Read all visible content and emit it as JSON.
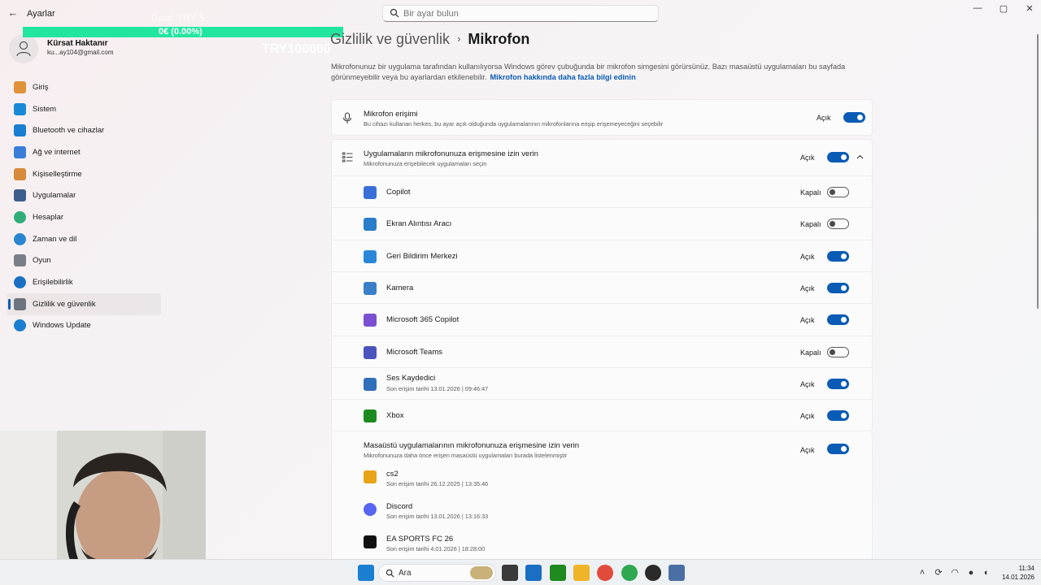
{
  "window": {
    "app_title": "Ayarlar",
    "search_placeholder": "Bir ayar bulun",
    "back_glyph": "←",
    "minimize_glyph": "—",
    "maximize_glyph": "▢",
    "close_glyph": "✕"
  },
  "overlay": {
    "progress_text": "0€ (0.00%)",
    "ghost_text": "Goal: TRY 5",
    "ghost_amount": "TRY100000",
    "bar_color": "#22e6a0"
  },
  "profile": {
    "name": "Kürsat Haktanır",
    "email": "ku...ay104@gmail.com"
  },
  "nav": {
    "items": [
      {
        "label": "Giriş",
        "icon": "home-icon",
        "color": "#e0923a"
      },
      {
        "label": "Sistem",
        "icon": "system-icon",
        "color": "#1a8ad6"
      },
      {
        "label": "Bluetooth ve cihazlar",
        "icon": "bluetooth-icon",
        "color": "#1a7fd0"
      },
      {
        "label": "Ağ ve internet",
        "icon": "network-icon",
        "color": "#3b7ed9"
      },
      {
        "label": "Kişiselleştirme",
        "icon": "brush-icon",
        "color": "#d68a3b"
      },
      {
        "label": "Uygulamalar",
        "icon": "apps-icon",
        "color": "#3d5e8c"
      },
      {
        "label": "Hesaplar",
        "icon": "accounts-icon",
        "color": "#2fae7a"
      },
      {
        "label": "Zaman ve dil",
        "icon": "time-language-icon",
        "color": "#2a86d1"
      },
      {
        "label": "Oyun",
        "icon": "gaming-icon",
        "color": "#7a7f87"
      },
      {
        "label": "Erişilebilirlik",
        "icon": "accessibility-icon",
        "color": "#1a6fc2"
      },
      {
        "label": "Gizlilik ve güvenlik",
        "icon": "shield-icon",
        "color": "#6d7480"
      },
      {
        "label": "Windows Update",
        "icon": "windows-update-icon",
        "color": "#1a7fd0"
      }
    ],
    "selected_index": 10
  },
  "page": {
    "crumb_parent": "Gizlilik ve güvenlik",
    "crumb_sep": "›",
    "crumb_current": "Mikrofon",
    "description": "Mikrofonunuz bir uygulama tarafından kullanılıyorsa Windows görev çubuğunda bir mikrofon simgesini görürsünüz. Bazı masaüstü uygulamaları bu sayfada görünmeyebilir veya bu ayarlardan etkilenebilir.",
    "learn_more": "Mikrofon hakkında daha fazla bilgi edinin"
  },
  "mic_access": {
    "title": "Mikrofon erişimi",
    "subtitle": "Bu cihazı kullanan herkes, bu ayar açık olduğunda uygulamalarının mikrofonlarına erişip erişemeyeceğini seçebilir",
    "state": "Açık"
  },
  "app_access": {
    "title": "Uygulamaların mikrofonunuza erişmesine izin verin",
    "subtitle": "Mikrofonunuza erişebilecek uygulamaları seçin",
    "state": "Açık",
    "apps": [
      {
        "name": "Copilot",
        "state": "Kapalı",
        "on": false,
        "sub": "",
        "icon": "copilot-icon",
        "color": "#3b6fd8"
      },
      {
        "name": "Ekran Alıntısı Aracı",
        "state": "Kapalı",
        "on": false,
        "sub": "",
        "icon": "snipping-tool-icon",
        "color": "#2a7ec9"
      },
      {
        "name": "Geri Bildirim Merkezi",
        "state": "Açık",
        "on": true,
        "sub": "",
        "icon": "feedback-hub-icon",
        "color": "#2b88d8"
      },
      {
        "name": "Kamera",
        "state": "Açık",
        "on": true,
        "sub": "",
        "icon": "camera-icon",
        "color": "#3a7fc8"
      },
      {
        "name": "Microsoft 365 Copilot",
        "state": "Açık",
        "on": true,
        "sub": "",
        "icon": "m365-copilot-icon",
        "color": "#7a4fd0"
      },
      {
        "name": "Microsoft Teams",
        "state": "Kapalı",
        "on": false,
        "sub": "",
        "icon": "teams-icon",
        "color": "#4b53bc"
      },
      {
        "name": "Ses Kaydedici",
        "state": "Açık",
        "on": true,
        "sub": "Son erişim tarihi 13.01.2026  |  09:46:47",
        "icon": "voice-recorder-icon",
        "color": "#2f6fb8"
      },
      {
        "name": "Xbox",
        "state": "Açık",
        "on": true,
        "sub": "",
        "icon": "xbox-icon",
        "color": "#1f8a1f"
      }
    ]
  },
  "desktop_access": {
    "title": "Masaüstü uygulamalarının mikrofonunuza erişmesine izin verin",
    "subtitle": "Mikrofonunuza daha önce erişen masaüstü uygulamaları burada listelenmiştir",
    "state": "Açık",
    "apps": [
      {
        "name": "cs2",
        "sub": "Son erişim tarihi 26.12.2025  |  13:35:46",
        "icon": "cs2-icon",
        "color": "#e8a317"
      },
      {
        "name": "Discord",
        "sub": "Son erişim tarihi 13.01.2026  |  13:16:33",
        "icon": "discord-icon",
        "color": "#5865f2"
      },
      {
        "name": "EA SPORTS FC 26",
        "sub": "Son erişim tarihi 4.01.2026  |  18:28:00",
        "icon": "ea-fc-icon",
        "color": "#111111"
      }
    ]
  },
  "taskbar": {
    "search_label": "Ara",
    "time": "11:34",
    "date": "14.01.2026",
    "items": [
      {
        "name": "start-button",
        "color": "#1a7fd0"
      },
      {
        "name": "task-view-button",
        "color": "#3a3a3a"
      },
      {
        "name": "outlook-taskbar-icon",
        "color": "#1a6fc2"
      },
      {
        "name": "xbox-taskbar-icon",
        "color": "#1f8a1f"
      },
      {
        "name": "file-explorer-taskbar-icon",
        "color": "#f0b429"
      },
      {
        "name": "chrome-taskbar-icon",
        "color": "#e24a3b"
      },
      {
        "name": "chrome-profile-taskbar-icon",
        "color": "#2fa84f"
      },
      {
        "name": "obs-taskbar-icon",
        "color": "#2a2a2a"
      },
      {
        "name": "settings-taskbar-icon",
        "color": "#4a6fa5"
      }
    ],
    "tray": [
      "chevron-up-icon",
      "sync-icon",
      "wifi-icon",
      "microphone-tray-icon",
      "volume-icon"
    ]
  }
}
